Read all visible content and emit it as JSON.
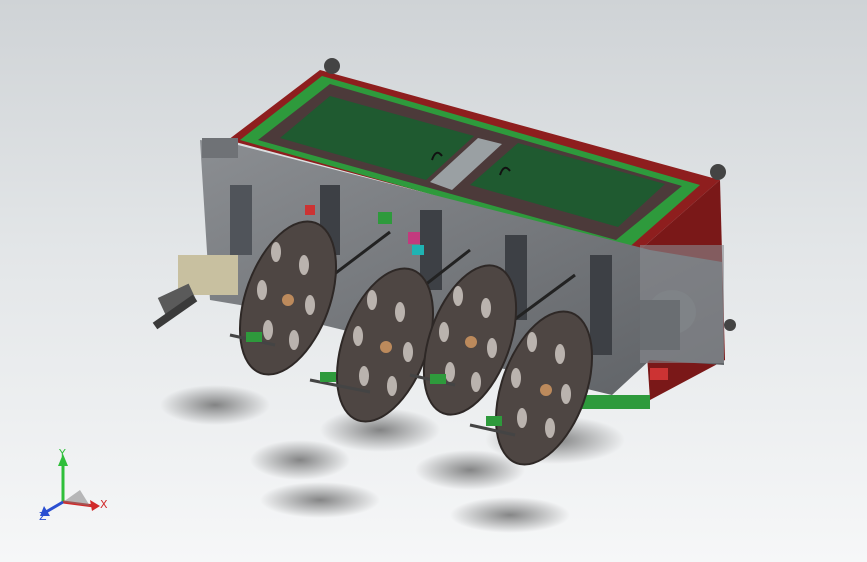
{
  "viewport": {
    "background_top": "#cfd3d6",
    "background_bottom": "#f6f7f8"
  },
  "model": {
    "frame_color": "#8e1e1e",
    "panel_color": "#1f5a30",
    "rail_color": "#2e9a3c",
    "plate_color": "#7a7c80",
    "reel_color": "#4e4643",
    "reel_count": 4
  },
  "triad": {
    "x_label": "X",
    "y_label": "Y",
    "z_label": "Z",
    "x_color": "#d12a2a",
    "y_color": "#2fbf3a",
    "z_color": "#2a4fd1"
  }
}
